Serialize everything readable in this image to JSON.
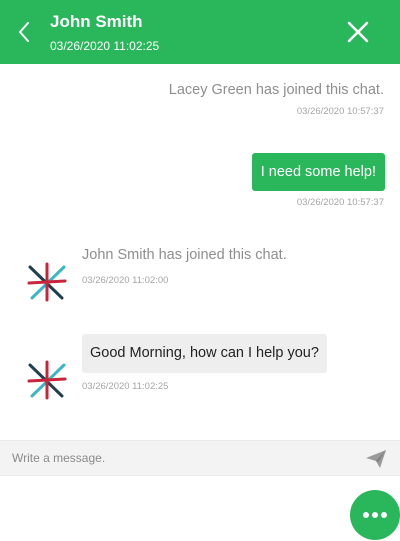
{
  "header": {
    "name": "John Smith",
    "timestamp": "03/26/2020 11:02:25",
    "back_icon": "chevron-left-icon",
    "close_icon": "close-icon",
    "background": "#2ab65a"
  },
  "messages": [
    {
      "kind": "system",
      "side": "right",
      "text": "Lacey Green has joined this chat.",
      "time": "03/26/2020 10:57:37"
    },
    {
      "kind": "outgoing",
      "text": "I need some help!",
      "time": "03/26/2020 10:57:37"
    },
    {
      "kind": "system",
      "side": "left",
      "text": "John Smith has joined this chat.",
      "time": "03/26/2020 11:02:00",
      "avatar_icon": "agent-logo-icon"
    },
    {
      "kind": "incoming",
      "text": "Good Morning, how can I help you?",
      "time": "03/26/2020 11:02:25",
      "avatar_icon": "agent-logo-icon"
    }
  ],
  "composer": {
    "placeholder": "Write a message.",
    "value": "",
    "send_icon": "send-icon"
  },
  "fab": {
    "icon": "more-dots-icon"
  },
  "colors": {
    "accent": "#2ab65a",
    "bubble_in": "#eeeeee",
    "muted_text": "#8e8e8e"
  }
}
